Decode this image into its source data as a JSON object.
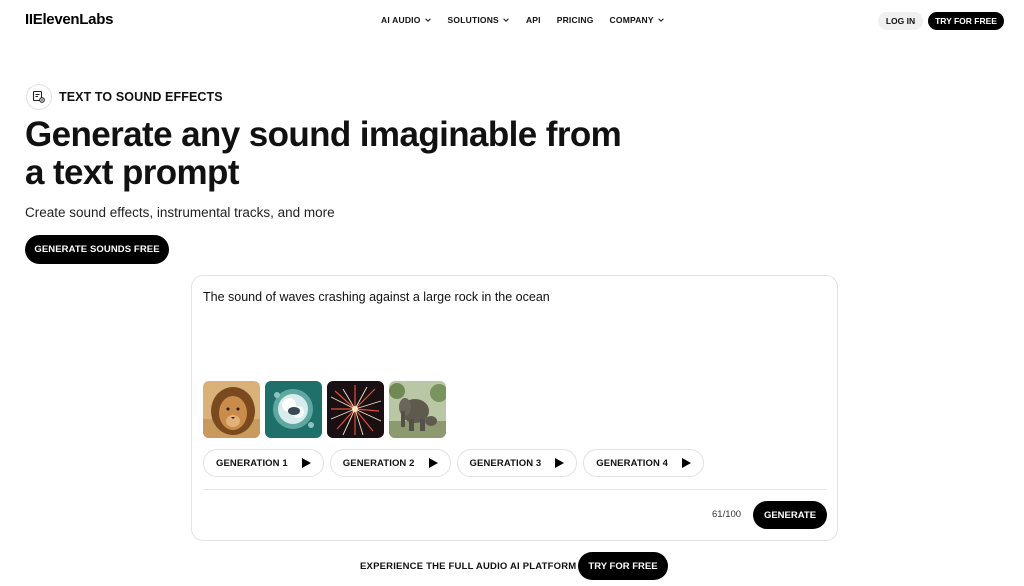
{
  "header": {
    "logo": "IIElevenLabs",
    "nav": [
      {
        "label": "AI AUDIO",
        "dropdown": true
      },
      {
        "label": "SOLUTIONS",
        "dropdown": true
      },
      {
        "label": "API",
        "dropdown": false
      },
      {
        "label": "PRICING",
        "dropdown": false
      },
      {
        "label": "COMPANY",
        "dropdown": true
      }
    ],
    "login_label": "LOG IN",
    "try_label": "TRY FOR FREE"
  },
  "hero": {
    "tag_icon": "sound-effects-icon",
    "tag_label": "TEXT TO SOUND EFFECTS",
    "headline": "Generate any sound imaginable from a text prompt",
    "subhead": "Create sound effects, instrumental tracks, and more",
    "cta_label": "GENERATE SOUNDS FREE"
  },
  "generator": {
    "prompt": "The sound of waves crashing against a large rock in the ocean",
    "thumbnails": [
      "lion",
      "ocean-waves",
      "fireworks",
      "elephant"
    ],
    "generations": [
      {
        "label": "GENERATION 1"
      },
      {
        "label": "GENERATION 2"
      },
      {
        "label": "GENERATION 3"
      },
      {
        "label": "GENERATION 4"
      }
    ],
    "char_count": "61/100",
    "generate_label": "GENERATE"
  },
  "footer": {
    "cta_text": "EXPERIENCE THE FULL AUDIO AI PLATFORM",
    "try_label": "TRY FOR FREE"
  },
  "colors": {
    "primary": "#000000",
    "background": "#ffffff",
    "border": "#e4e4e4",
    "pill_bg": "#f0f0f0"
  }
}
